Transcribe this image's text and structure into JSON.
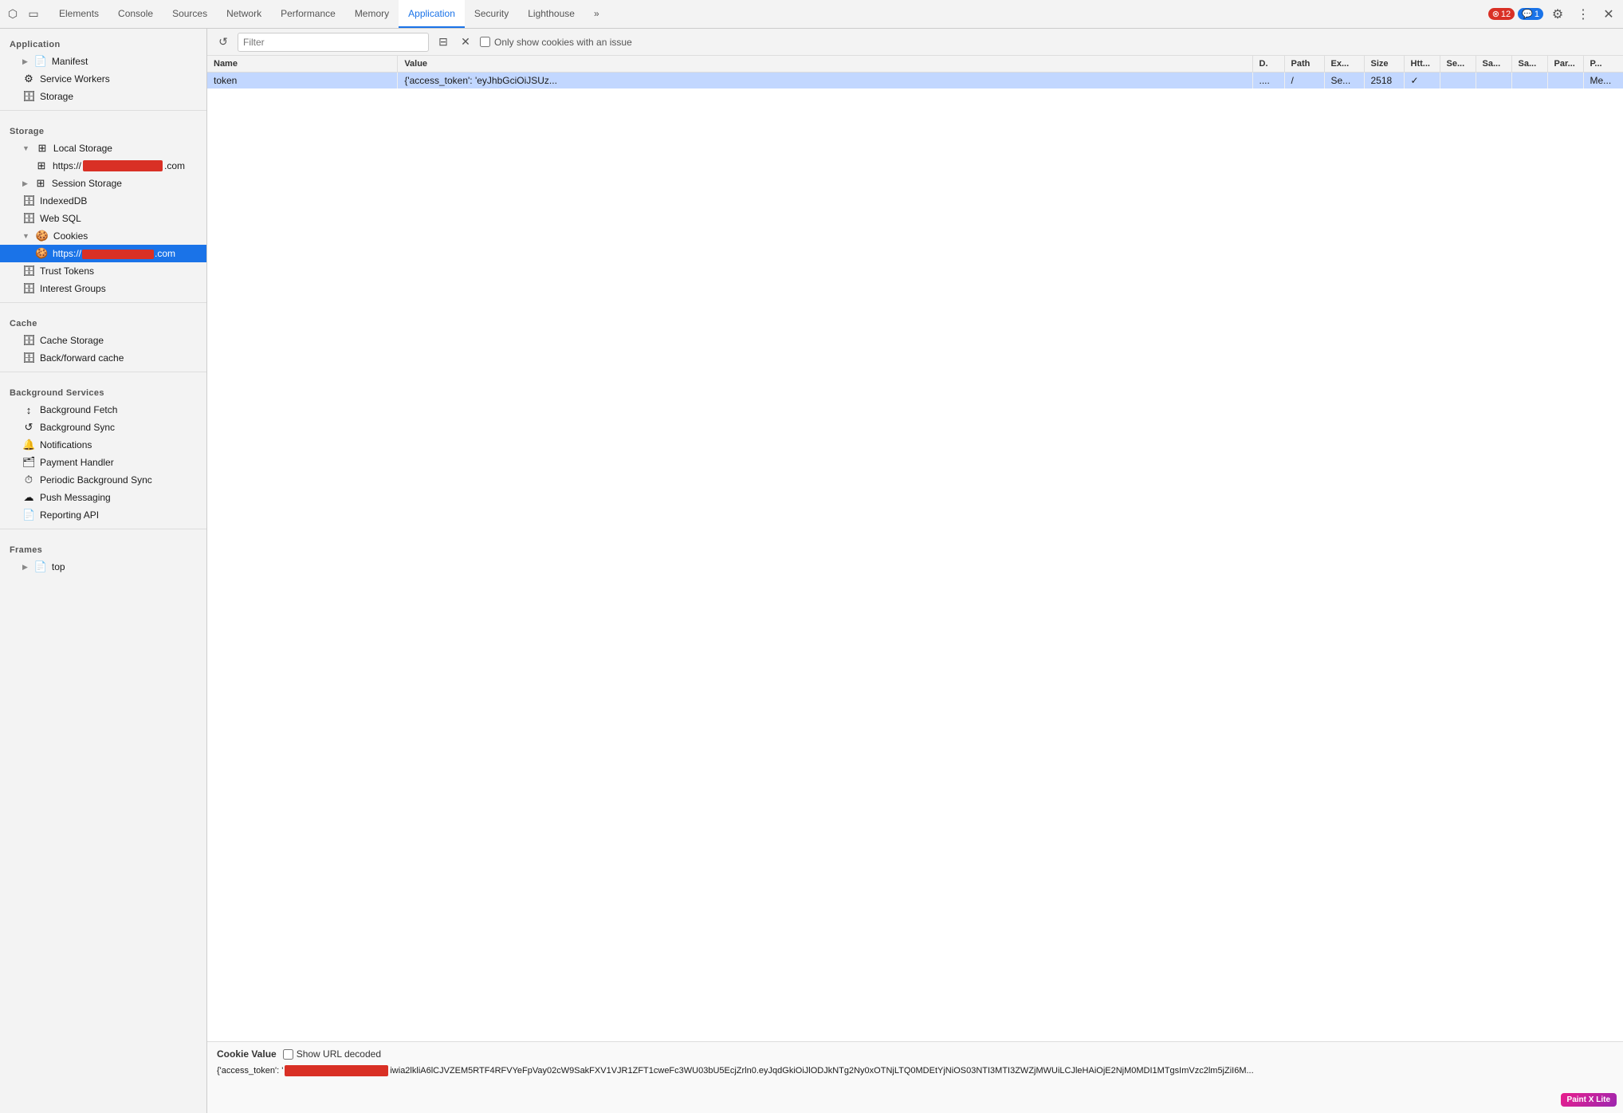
{
  "topbar": {
    "tabs": [
      {
        "id": "elements",
        "label": "Elements",
        "active": false
      },
      {
        "id": "console",
        "label": "Console",
        "active": false
      },
      {
        "id": "sources",
        "label": "Sources",
        "active": false
      },
      {
        "id": "network",
        "label": "Network",
        "active": false
      },
      {
        "id": "performance",
        "label": "Performance",
        "active": false
      },
      {
        "id": "memory",
        "label": "Memory",
        "active": false
      },
      {
        "id": "application",
        "label": "Application",
        "active": true
      },
      {
        "id": "security",
        "label": "Security",
        "active": false
      },
      {
        "id": "lighthouse",
        "label": "Lighthouse",
        "active": false
      }
    ],
    "more_label": "»",
    "badge_red_count": "12",
    "badge_blue_count": "1"
  },
  "sidebar": {
    "application_section": "Application",
    "items_app": [
      {
        "id": "manifest",
        "label": "Manifest",
        "icon": "📄",
        "indent": 1
      },
      {
        "id": "service-workers",
        "label": "Service Workers",
        "icon": "⚙️",
        "indent": 1
      },
      {
        "id": "storage",
        "label": "Storage",
        "icon": "🗄",
        "indent": 1
      }
    ],
    "storage_section": "Storage",
    "items_storage": [
      {
        "id": "local-storage",
        "label": "Local Storage",
        "icon": "⊞",
        "indent": 1,
        "expand": true
      },
      {
        "id": "local-storage-url",
        "label": "https://",
        "icon": "⊞",
        "indent": 2,
        "redacted": true
      },
      {
        "id": "session-storage",
        "label": "Session Storage",
        "icon": "⊞",
        "indent": 1,
        "expand": true
      },
      {
        "id": "indexeddb",
        "label": "IndexedDB",
        "icon": "🗄",
        "indent": 1
      },
      {
        "id": "web-sql",
        "label": "Web SQL",
        "icon": "🗄",
        "indent": 1
      },
      {
        "id": "cookies",
        "label": "Cookies",
        "icon": "🍪",
        "indent": 1,
        "expand": true,
        "expanded": true
      },
      {
        "id": "cookies-url",
        "label": "https://",
        "icon": "🍪",
        "indent": 2,
        "redacted": true,
        "active": true
      },
      {
        "id": "trust-tokens",
        "label": "Trust Tokens",
        "icon": "🗄",
        "indent": 1
      },
      {
        "id": "interest-groups",
        "label": "Interest Groups",
        "icon": "🗄",
        "indent": 1
      }
    ],
    "cache_section": "Cache",
    "items_cache": [
      {
        "id": "cache-storage",
        "label": "Cache Storage",
        "icon": "🗄",
        "indent": 1
      },
      {
        "id": "back-forward-cache",
        "label": "Back/forward cache",
        "icon": "🗄",
        "indent": 1
      }
    ],
    "bg_services_section": "Background Services",
    "items_bg": [
      {
        "id": "bg-fetch",
        "label": "Background Fetch",
        "icon": "↕",
        "indent": 1
      },
      {
        "id": "bg-sync",
        "label": "Background Sync",
        "icon": "↺",
        "indent": 1
      },
      {
        "id": "notifications",
        "label": "Notifications",
        "icon": "🔔",
        "indent": 1
      },
      {
        "id": "payment-handler",
        "label": "Payment Handler",
        "icon": "🗂",
        "indent": 1
      },
      {
        "id": "periodic-bg-sync",
        "label": "Periodic Background Sync",
        "icon": "⏱",
        "indent": 1
      },
      {
        "id": "push-messaging",
        "label": "Push Messaging",
        "icon": "☁",
        "indent": 1
      },
      {
        "id": "reporting-api",
        "label": "Reporting API",
        "icon": "📄",
        "indent": 1
      }
    ],
    "frames_section": "Frames",
    "items_frames": [
      {
        "id": "top-frame",
        "label": "top",
        "icon": "📄",
        "indent": 1,
        "expand": true
      }
    ]
  },
  "cookie_toolbar": {
    "filter_placeholder": "Filter",
    "only_issue_label": "Only show cookies with an issue"
  },
  "cookie_table": {
    "columns": [
      "Name",
      "Value",
      "D.",
      "Path",
      "Ex...",
      "Size",
      "Htt...",
      "Se...",
      "Sa...",
      "Sa...",
      "Par...",
      "P..."
    ],
    "rows": [
      {
        "name": "token",
        "value": "{'access_token': 'eyJhbGciOiJSUz...",
        "domain": "....",
        "path": "/",
        "expires": "Se...",
        "size": "2518",
        "http_only": "✓",
        "secure": "",
        "same_site": "",
        "same_party": "",
        "partition": "",
        "priority": "Me..."
      }
    ]
  },
  "cookie_value_panel": {
    "title": "Cookie Value",
    "show_url_decoded_label": "Show URL decoded",
    "value_prefix": "{'access_token': '",
    "value_body": "iwia2lkliA6lCJVZEM5RTF4RFVYeFpVay02cW9SakFXV1VJR1ZFT1cweFc3WU03bU5EcjZrln0.eyJqdGkiOiJlODJkNTg2Ny0xOTNjLTQ0MDEtYjNiOS03NTI3MTI3ZWZjMWUiLCJleHAiOjE2NjM0MDI1MTgsImVzc2lm5jZiI6M...",
    "value_suffix": ""
  },
  "paint_x_badge": "Paint X Lite"
}
